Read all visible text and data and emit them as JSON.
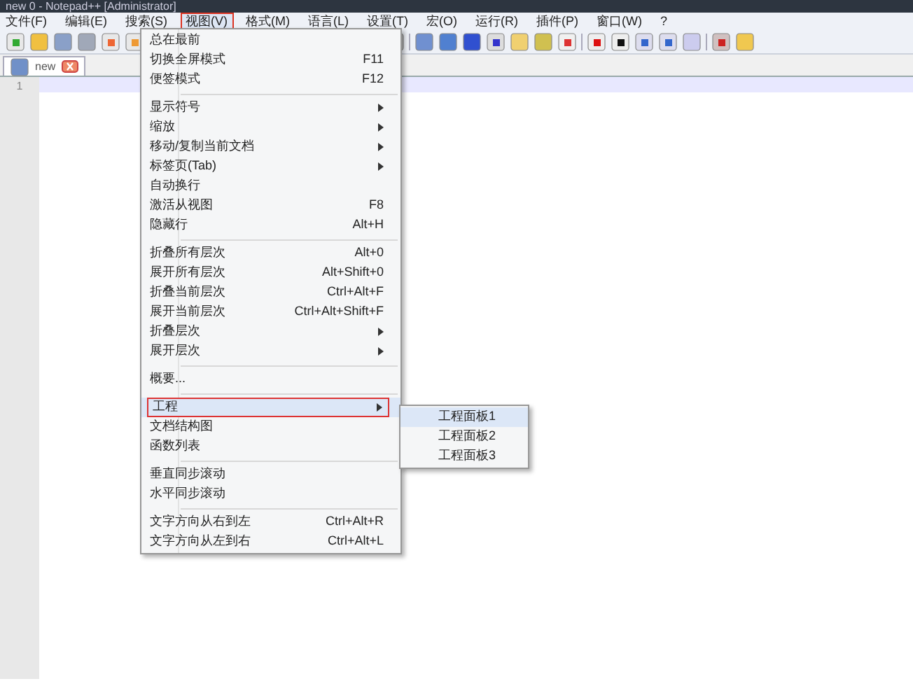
{
  "window": {
    "title": "new 0 - Notepad++ [Administrator]"
  },
  "menu_bar": [
    {
      "label": "文件(F)",
      "selected": false
    },
    {
      "label": "编辑(E)",
      "selected": false
    },
    {
      "label": "搜索(S)",
      "selected": false
    },
    {
      "label": "视图(V)",
      "selected": true
    },
    {
      "label": "格式(M)",
      "selected": false
    },
    {
      "label": "语言(L)",
      "selected": false
    },
    {
      "label": "设置(T)",
      "selected": false
    },
    {
      "label": "宏(O)",
      "selected": false
    },
    {
      "label": "运行(R)",
      "selected": false
    },
    {
      "label": "插件(P)",
      "selected": false
    },
    {
      "label": "窗口(W)",
      "selected": false
    },
    {
      "label": "?",
      "selected": false
    }
  ],
  "tabs": [
    {
      "label": "new",
      "selected": true
    }
  ],
  "editor": {
    "line_numbers": [
      "1"
    ]
  },
  "view_menu": [
    {
      "kind": "item",
      "label": "总在最前",
      "selected": false
    },
    {
      "kind": "item",
      "label": "切换全屏模式",
      "shortcut": "F11",
      "selected": false
    },
    {
      "kind": "item",
      "label": "便签模式",
      "shortcut": "F12",
      "selected": false
    },
    {
      "kind": "separator"
    },
    {
      "kind": "submenu",
      "label": "显示符号",
      "selected": false
    },
    {
      "kind": "submenu",
      "label": "缩放",
      "selected": false
    },
    {
      "kind": "submenu",
      "label": "移动/复制当前文档",
      "selected": false
    },
    {
      "kind": "submenu",
      "label": "标签页(Tab)",
      "selected": false
    },
    {
      "kind": "item",
      "label": "自动换行",
      "selected": false
    },
    {
      "kind": "item",
      "label": "激活从视图",
      "shortcut": "F8",
      "selected": false
    },
    {
      "kind": "item",
      "label": "隐藏行",
      "shortcut": "Alt+H",
      "selected": false
    },
    {
      "kind": "separator"
    },
    {
      "kind": "item",
      "label": "折叠所有层次",
      "shortcut": "Alt+0",
      "selected": false
    },
    {
      "kind": "item",
      "label": "展开所有层次",
      "shortcut": "Alt+Shift+0",
      "selected": false
    },
    {
      "kind": "item",
      "label": "折叠当前层次",
      "shortcut": "Ctrl+Alt+F",
      "selected": false
    },
    {
      "kind": "item",
      "label": "展开当前层次",
      "shortcut": "Ctrl+Alt+Shift+F",
      "selected": false
    },
    {
      "kind": "submenu",
      "label": "折叠层次",
      "selected": false
    },
    {
      "kind": "submenu",
      "label": "展开层次",
      "selected": false
    },
    {
      "kind": "separator"
    },
    {
      "kind": "item",
      "label": "概要...",
      "selected": false
    },
    {
      "kind": "separator"
    },
    {
      "kind": "submenu",
      "label": "工程",
      "selected": true
    },
    {
      "kind": "item",
      "label": "文档结构图",
      "selected": false
    },
    {
      "kind": "item",
      "label": "函数列表",
      "selected": false
    },
    {
      "kind": "separator"
    },
    {
      "kind": "item",
      "label": "垂直同步滚动",
      "selected": false
    },
    {
      "kind": "item",
      "label": "水平同步滚动",
      "selected": false
    },
    {
      "kind": "separator"
    },
    {
      "kind": "item",
      "label": "文字方向从右到左",
      "shortcut": "Ctrl+Alt+R",
      "selected": false
    },
    {
      "kind": "item",
      "label": "文字方向从左到右",
      "shortcut": "Ctrl+Alt+L",
      "selected": false
    }
  ],
  "project_submenu": [
    {
      "label": "工程面板1",
      "selected": true
    },
    {
      "label": "工程面板2",
      "selected": false
    },
    {
      "label": "工程面板3",
      "selected": false
    }
  ]
}
